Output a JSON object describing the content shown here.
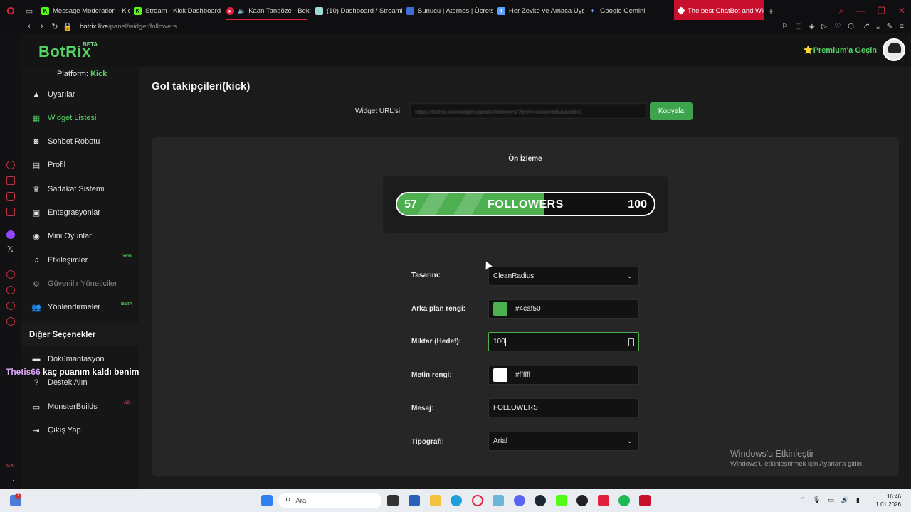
{
  "browser": {
    "tabs": [
      {
        "label": "Message Moderation - Kic",
        "color": "#53fc18",
        "active": false
      },
      {
        "label": "Stream - Kick Dashboard",
        "color": "#53fc18",
        "active": false
      },
      {
        "label": "Kaan Tangöze - Bekle",
        "color": "#e0203c",
        "active": false,
        "playing": true
      },
      {
        "label": "(10) Dashboard / Streamla",
        "color": "#9adcd2",
        "active": false
      },
      {
        "label": "Sunucu | Aternos | Ücrets",
        "color": "#3b6ed6",
        "active": false
      },
      {
        "label": "Her Zevke ve Amaca Uyg",
        "color": "#5aa0ff",
        "active": false
      },
      {
        "label": "Google Gemini",
        "color": "#7aa7ff",
        "active": false
      },
      {
        "label": "The best ChatBot and Wid",
        "color": "#ffffff",
        "active": true
      }
    ],
    "url_host": "botrix.live",
    "url_path": "/panel/widget/followers"
  },
  "header": {
    "logo": "BotRix",
    "logo_badge": "BETA",
    "premium": "⭐Premium'a Geçin"
  },
  "sidebar": {
    "platform_label": "Platform: ",
    "platform_value": "Kick",
    "items": [
      {
        "label": "Uyarılar",
        "icon": "warning-icon"
      },
      {
        "label": "Widget Listesi",
        "icon": "grid-icon",
        "active": true
      },
      {
        "label": "Sohbet Robotu",
        "icon": "robot-icon"
      },
      {
        "label": "Profil",
        "icon": "id-card-icon"
      },
      {
        "label": "Sadakat Sistemi",
        "icon": "trophy-icon"
      },
      {
        "label": "Entegrasyonlar",
        "icon": "integration-icon"
      },
      {
        "label": "Mini Oyunlar",
        "icon": "gamepad-icon"
      },
      {
        "label": "Etkileşimler",
        "icon": "music-icon",
        "badge": "YENİ"
      },
      {
        "label": "Güvenilir Yöneticiler",
        "icon": "users-cog-icon",
        "disabled": true
      },
      {
        "label": "Yönlendirmeler",
        "icon": "users-icon",
        "badge": "BETA"
      }
    ],
    "section_title": "Diğer Seçenekler",
    "other_items": [
      {
        "label": "Dokümantasyon",
        "icon": "document-icon"
      },
      {
        "label": "Destek Alın",
        "icon": "question-icon"
      },
      {
        "label": "MonsterBuilds",
        "icon": "laptop-icon",
        "badge": "AD"
      },
      {
        "label": "Çıkış Yap",
        "icon": "logout-icon"
      }
    ]
  },
  "chat_overlay": {
    "user": "Thetis66",
    "message": "kaç puanım kaldı benim"
  },
  "page": {
    "title": "Gol takipçileri(kick)",
    "widget_url_label": "Widget URL'si:",
    "widget_url_value": "https://botrix.live/widgets/goals/followers/?bnm=cleanradius&bid=1",
    "copy_button": "Kopyala",
    "preview_label": "Ön İzleme"
  },
  "goal_preview": {
    "current": "57",
    "message": "FOLLOWERS",
    "target": "100",
    "progress": 0.57,
    "fill_color": "#4caf50",
    "text_color": "#ffffff"
  },
  "form": {
    "design_label": "Tasarım:",
    "design_value": "CleanRadius",
    "bg_color_label": "Arka plan rengi:",
    "bg_color_value": "#4caf50",
    "amount_label": "Miktar (Hedef):",
    "amount_value": "100",
    "text_color_label": "Metin rengi:",
    "text_color_value": "#ffffff",
    "message_label": "Mesaj:",
    "message_value": "FOLLOWERS",
    "typography_label": "Tipografi:",
    "typography_value": "Arial"
  },
  "watermark": {
    "line1": "Windows'u Etkinleştir",
    "line2": "Windows'u etkinleştirmek için Ayarlar'a gidin."
  },
  "taskbar": {
    "search_placeholder": "Ara",
    "time": "16:46",
    "date": "1.01.2026",
    "notif_count": "7"
  }
}
